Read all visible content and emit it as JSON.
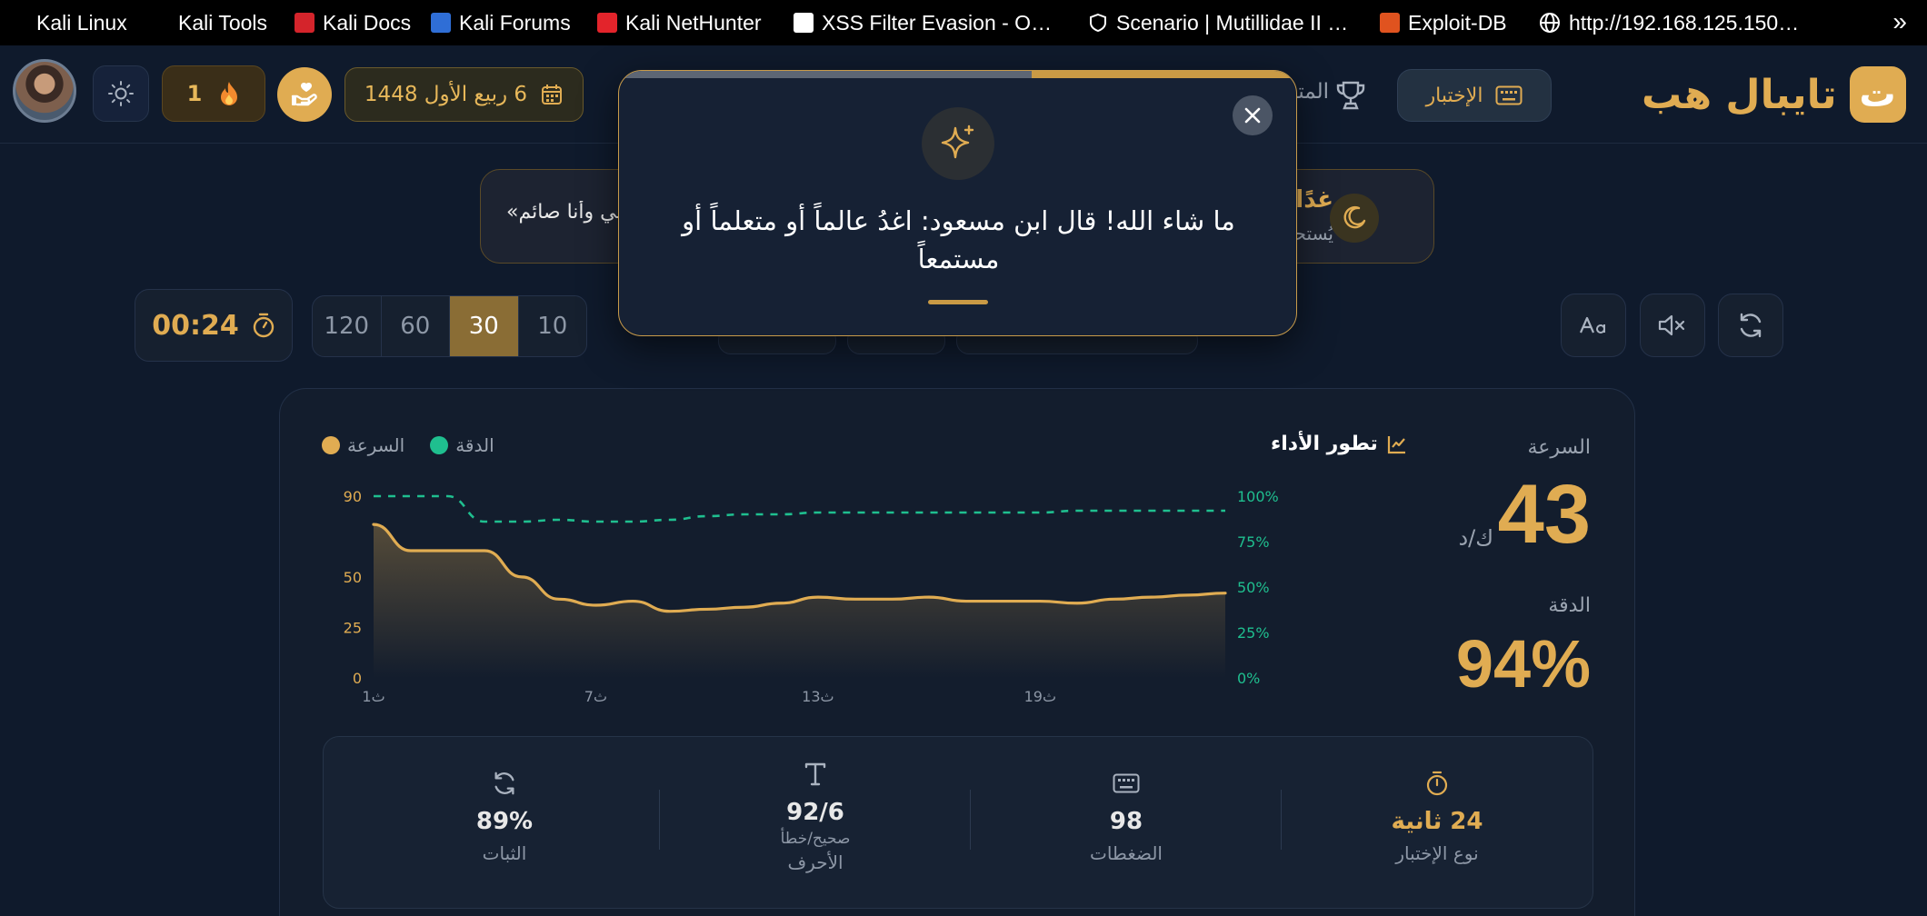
{
  "bookmarks": [
    {
      "label": "Kali Linux",
      "icon": "kali-dragon-icon"
    },
    {
      "label": "Kali Tools",
      "icon": "kali-dragon-icon"
    },
    {
      "label": "Kali Docs",
      "icon": "kali-docs-icon"
    },
    {
      "label": "Kali Forums",
      "icon": "kali-forums-icon"
    },
    {
      "label": "Kali NetHunter",
      "icon": "nethunter-icon"
    },
    {
      "label": "XSS Filter Evasion - O…",
      "icon": "owasp-icon"
    },
    {
      "label": "Scenario | Mutillidae II …",
      "icon": "mutillidae-icon"
    },
    {
      "label": "Exploit-DB",
      "icon": "exploit-db-icon"
    },
    {
      "label": "http://192.168.125.150…",
      "icon": "globe-icon"
    }
  ],
  "header": {
    "brand": "تايبال هب",
    "brand_logo_letter": "ت",
    "test_button": "الإختبار",
    "nav_partial": "المتصدرين",
    "date": "6 ربيع الأول 1448",
    "streak_count": "1"
  },
  "notice": {
    "title": "غدًا",
    "subtitle": "يُستحب",
    "quote": "«إني أصلي وأنا صائم»"
  },
  "toolbar": {
    "timer": "00:24",
    "durations": [
      "120",
      "60",
      "30",
      "10"
    ],
    "active_duration": "30"
  },
  "modal": {
    "message": "ما شاء الله! قال ابن مسعود: اغدُ عالماً أو متعلماً أو مستمعاً",
    "progress": 0.39
  },
  "results": {
    "speed_label": "السرعة",
    "speed_value": "43",
    "speed_unit": "ك/د",
    "accuracy_label": "الدقة",
    "accuracy_value": "94%",
    "chart_title": "تطور الأداء",
    "legend_speed": "السرعة",
    "legend_accuracy": "الدقة",
    "stats": [
      {
        "value": "24 ثانية",
        "label": "نوع الإختبار",
        "icon": "stopwatch-icon"
      },
      {
        "value": "98",
        "label": "الضغطات",
        "icon": "keyboard-icon"
      },
      {
        "value": "92/6",
        "sub": "صحيح/خطأ",
        "label": "الأحرف",
        "icon": "text-icon"
      },
      {
        "value": "89%",
        "label": "الثبات",
        "icon": "refresh-icon"
      }
    ]
  },
  "colors": {
    "accent": "#e0ac52",
    "accuracy": "#1fbf8f",
    "background": "#0f1a2c"
  },
  "chart_data": {
    "type": "line",
    "title": "تطور الأداء",
    "x_ticks": [
      "ث1",
      "ث7",
      "ث13",
      "ث19"
    ],
    "x": [
      1,
      2,
      3,
      4,
      5,
      6,
      7,
      8,
      9,
      10,
      11,
      12,
      13,
      14,
      15,
      16,
      17,
      18,
      19,
      20,
      21,
      22,
      23,
      24
    ],
    "left_axis": {
      "ticks": [
        "0",
        "25",
        "50",
        "90"
      ],
      "ylim": [
        0,
        90
      ]
    },
    "right_axis": {
      "ticks": [
        "0%",
        "25%",
        "50%",
        "75%",
        "100%"
      ],
      "ylim": [
        0,
        100
      ]
    },
    "series": [
      {
        "name": "السرعة",
        "axis": "left",
        "color": "#e0ac52",
        "style": "solid",
        "values": [
          76,
          63,
          63,
          63,
          50,
          39,
          36,
          38,
          33,
          34,
          35,
          37,
          40,
          39,
          39,
          40,
          38,
          38,
          38,
          37,
          39,
          40,
          41,
          42
        ]
      },
      {
        "name": "الدقة",
        "axis": "right",
        "color": "#1fbf8f",
        "style": "dashed",
        "values": [
          100,
          100,
          100,
          86,
          86,
          87,
          86,
          86,
          87,
          89,
          90,
          90,
          91,
          91,
          91,
          91,
          91,
          91,
          91,
          92,
          92,
          92,
          92,
          92
        ]
      }
    ],
    "legend": "top-left",
    "grid": false
  }
}
